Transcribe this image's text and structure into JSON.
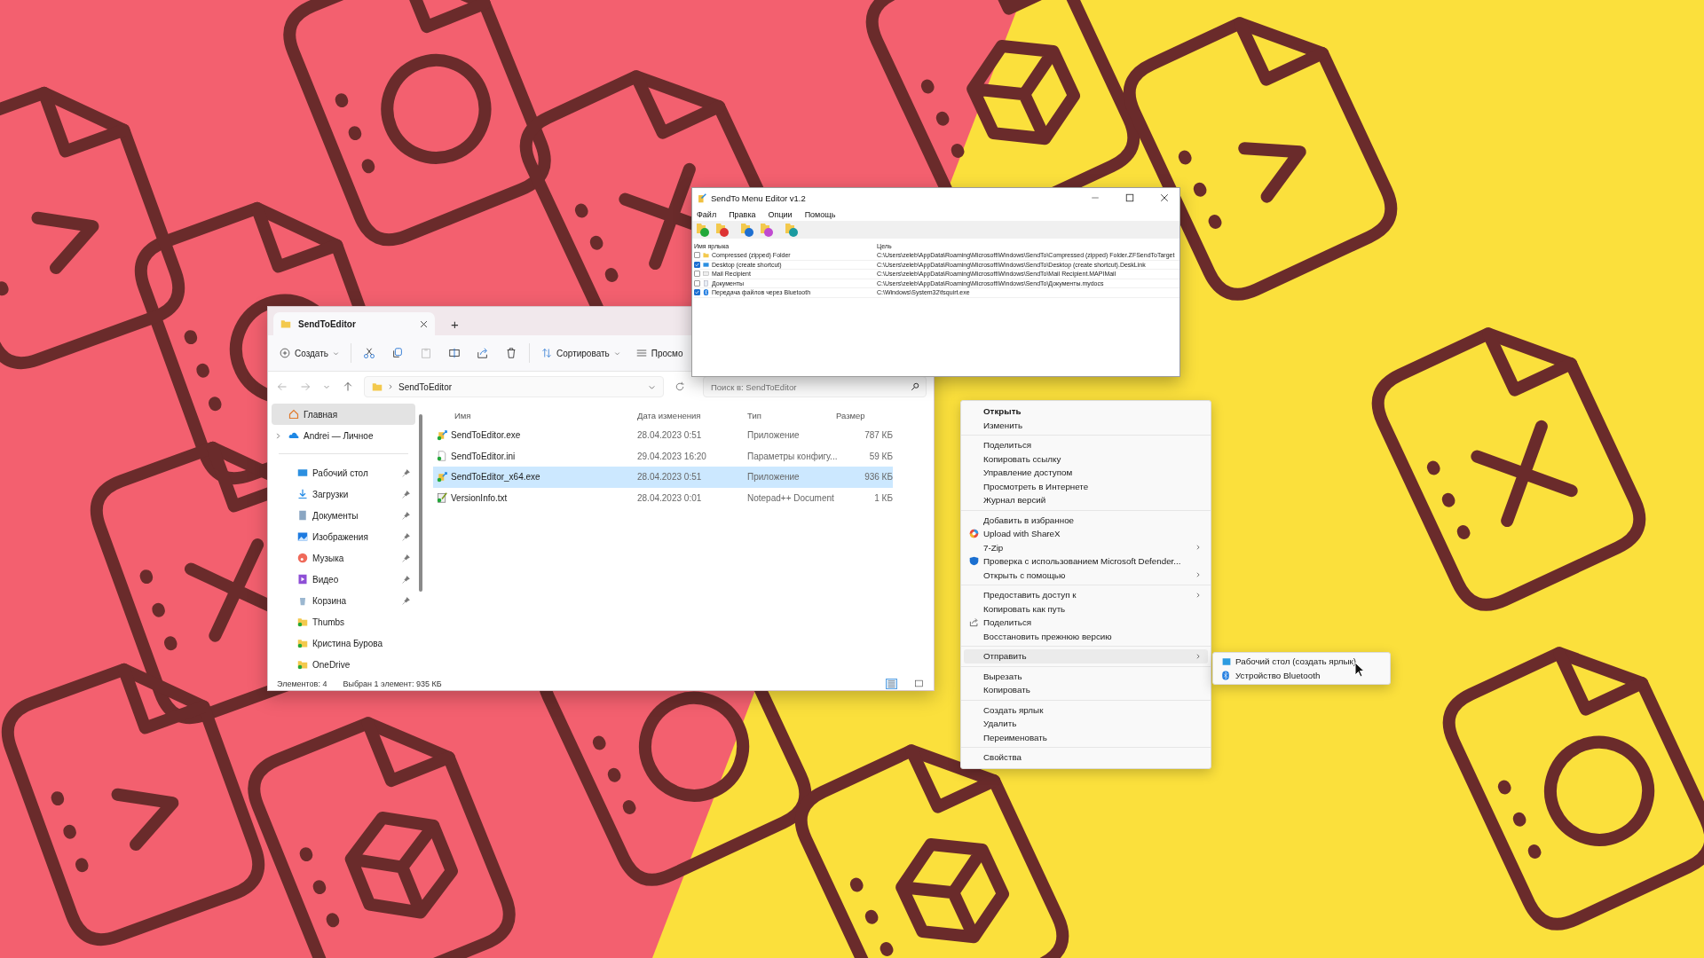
{
  "explorer": {
    "tabs": [
      {
        "label": "SendToEditor",
        "selected": true
      }
    ],
    "new_tab": "+",
    "toolbar": {
      "create": "Создать",
      "sort": "Сортировать",
      "view": "Просмо"
    },
    "address": "SendToEditor",
    "search": {
      "placeholder": "Поиск в: SendToEditor"
    },
    "sidebar": {
      "sections": [
        {
          "items": [
            {
              "label": "Главная",
              "selected": true,
              "pinned": false,
              "expandable": false
            },
            {
              "label": "Andrei — Личное",
              "selected": false,
              "pinned": false,
              "expandable": true
            }
          ]
        },
        {
          "items": [
            {
              "label": "Рабочий стол",
              "selected": false,
              "pinned": true,
              "expandable": false
            },
            {
              "label": "Загрузки",
              "selected": false,
              "pinned": true,
              "expandable": false
            },
            {
              "label": "Документы",
              "selected": false,
              "pinned": true,
              "expandable": false
            },
            {
              "label": "Изображения",
              "selected": false,
              "pinned": true,
              "expandable": false
            },
            {
              "label": "Музыка",
              "selected": false,
              "pinned": true,
              "expandable": false
            },
            {
              "label": "Видео",
              "selected": false,
              "pinned": true,
              "expandable": false
            },
            {
              "label": "Корзина",
              "selected": false,
              "pinned": true,
              "expandable": false
            },
            {
              "label": "Thumbs",
              "selected": false,
              "pinned": false,
              "expandable": false
            },
            {
              "label": "Кристина Бурова",
              "selected": false,
              "pinned": false,
              "expandable": false
            },
            {
              "label": "OneDrive",
              "selected": false,
              "pinned": false,
              "expandable": false
            }
          ]
        }
      ]
    },
    "columns": [
      "Имя",
      "Дата изменения",
      "Тип",
      "Размер"
    ],
    "files": [
      {
        "name": "SendToEditor.exe",
        "date": "28.04.2023 0:51",
        "type": "Приложение",
        "size": "787 КБ",
        "selected": false
      },
      {
        "name": "SendToEditor.ini",
        "date": "29.04.2023 16:20",
        "type": "Параметры конфигу...",
        "size": "59 КБ",
        "selected": false
      },
      {
        "name": "SendToEditor_x64.exe",
        "date": "28.04.2023 0:51",
        "type": "Приложение",
        "size": "936 КБ",
        "selected": true
      },
      {
        "name": "VersionInfo.txt",
        "date": "28.04.2023 0:01",
        "type": "Notepad++ Document",
        "size": "1 КБ",
        "selected": false
      }
    ],
    "status": [
      "Элементов: 4",
      "Выбран 1 элемент: 935 КБ"
    ],
    "view_modes": [
      {
        "selected": true
      },
      {
        "selected": false
      }
    ]
  },
  "editor": {
    "title": "SendTo Menu Editor v1.2",
    "menu": [
      "Файл",
      "Правка",
      "Опции",
      "Помощь"
    ],
    "columns": [
      "Имя ярлыка",
      "Цель"
    ],
    "rows": [
      {
        "name": "Compressed (zipped) Folder",
        "target": "C:\\Users\\zeleb\\AppData\\Roaming\\Microsoft\\Windows\\SendTo\\Compressed (zipped) Folder.ZFSendToTarget",
        "checked": false
      },
      {
        "name": "Desktop (create shortcut)",
        "target": "C:\\Users\\zeleb\\AppData\\Roaming\\Microsoft\\Windows\\SendTo\\Desktop (create shortcut).DeskLink",
        "checked": true
      },
      {
        "name": "Mail Recipient",
        "target": "C:\\Users\\zeleb\\AppData\\Roaming\\Microsoft\\Windows\\SendTo\\Mail Recipient.MAPIMail",
        "checked": false
      },
      {
        "name": "Документы",
        "target": "C:\\Users\\zeleb\\AppData\\Roaming\\Microsoft\\Windows\\SendTo\\Документы.mydocs",
        "checked": false
      },
      {
        "name": "Передача файлов через Bluetooth",
        "target": "C:\\Windows\\System32\\fsquirt.exe",
        "checked": true
      }
    ]
  },
  "context_menu": {
    "sections": [
      {
        "items": [
          {
            "label": "Открыть",
            "default": true,
            "submenu": false,
            "selected": false
          },
          {
            "label": "Изменить",
            "default": false,
            "submenu": false,
            "selected": false
          }
        ]
      },
      {
        "items": [
          {
            "label": "Поделиться",
            "default": false,
            "submenu": false,
            "selected": false
          },
          {
            "label": "Копировать ссылку",
            "default": false,
            "submenu": false,
            "selected": false
          },
          {
            "label": "Управление доступом",
            "default": false,
            "submenu": false,
            "selected": false
          },
          {
            "label": "Просмотреть в Интернете",
            "default": false,
            "submenu": false,
            "selected": false
          },
          {
            "label": "Журнал версий",
            "default": false,
            "submenu": false,
            "selected": false
          }
        ]
      },
      {
        "items": [
          {
            "label": "Добавить в избранное",
            "default": false,
            "submenu": false,
            "selected": false
          },
          {
            "label": "Upload with ShareX",
            "default": false,
            "submenu": false,
            "selected": false
          },
          {
            "label": "7-Zip",
            "default": false,
            "submenu": true,
            "selected": false
          },
          {
            "label": "Проверка с использованием Microsoft Defender...",
            "default": false,
            "submenu": false,
            "selected": false
          },
          {
            "label": "Открыть с помощью",
            "default": false,
            "submenu": true,
            "selected": false
          }
        ]
      },
      {
        "items": [
          {
            "label": "Предоставить доступ к",
            "default": false,
            "submenu": true,
            "selected": false
          },
          {
            "label": "Копировать как путь",
            "default": false,
            "submenu": false,
            "selected": false
          },
          {
            "label": "Поделиться",
            "default": false,
            "submenu": false,
            "selected": false
          },
          {
            "label": "Восстановить прежнюю версию",
            "default": false,
            "submenu": false,
            "selected": false
          }
        ]
      },
      {
        "items": [
          {
            "label": "Отправить",
            "default": false,
            "submenu": true,
            "selected": true
          }
        ]
      },
      {
        "items": [
          {
            "label": "Вырезать",
            "default": false,
            "submenu": false,
            "selected": false
          },
          {
            "label": "Копировать",
            "default": false,
            "submenu": false,
            "selected": false
          }
        ]
      },
      {
        "items": [
          {
            "label": "Создать ярлык",
            "default": false,
            "submenu": false,
            "selected": false
          },
          {
            "label": "Удалить",
            "default": false,
            "submenu": false,
            "selected": false
          },
          {
            "label": "Переименовать",
            "default": false,
            "submenu": false,
            "selected": false
          }
        ]
      },
      {
        "items": [
          {
            "label": "Свойства",
            "default": false,
            "submenu": false,
            "selected": false
          }
        ]
      }
    ]
  },
  "submenu": {
    "items": [
      {
        "label": "Рабочий стол (создать ярлык)"
      },
      {
        "label": "Устройство Bluetooth"
      }
    ]
  }
}
